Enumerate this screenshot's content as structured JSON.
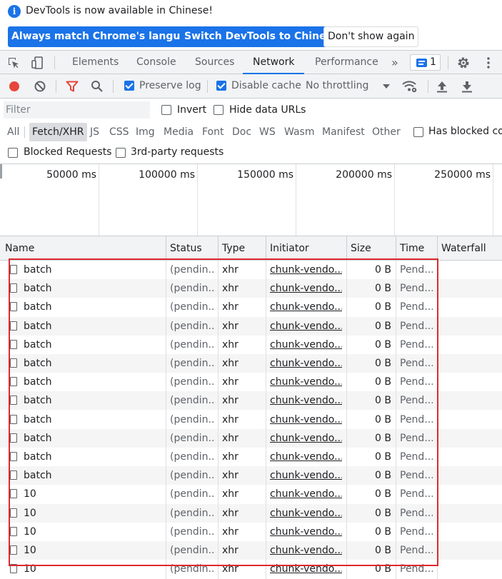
{
  "infobar": {
    "message": "DevTools is now available in Chinese!",
    "button_match": "Always match Chrome's language",
    "button_switch": "Switch DevTools to Chinese",
    "button_dismiss": "Don't show again"
  },
  "tabs": {
    "elements": "Elements",
    "console": "Console",
    "sources": "Sources",
    "network": "Network",
    "performance": "Performance",
    "more": "»",
    "issues_count": "1",
    "active": "Network"
  },
  "toolbar": {
    "preserve_log": "Preserve log",
    "preserve_log_checked": true,
    "disable_cache": "Disable cache",
    "disable_cache_checked": true,
    "throttling": "No throttling"
  },
  "filter": {
    "placeholder": "Filter",
    "invert": "Invert",
    "hide_data_urls": "Hide data URLs",
    "types": [
      "All",
      "Fetch/XHR",
      "JS",
      "CSS",
      "Img",
      "Media",
      "Font",
      "Doc",
      "WS",
      "Wasm",
      "Manifest",
      "Other"
    ],
    "active_type": "Fetch/XHR",
    "has_blocked_cookies": "Has blocked coo",
    "blocked_requests": "Blocked Requests",
    "third_party": "3rd-party requests"
  },
  "overview": {
    "ticks": [
      "50000 ms",
      "100000 ms",
      "150000 ms",
      "200000 ms",
      "250000 ms"
    ]
  },
  "table": {
    "headers": [
      "Name",
      "Status",
      "Type",
      "Initiator",
      "Size",
      "Time",
      "Waterfall"
    ],
    "rows": [
      {
        "name": "batch",
        "status": "(pendin...",
        "type": "xhr",
        "initiator": "chunk-vendo...",
        "size": "0 B",
        "time": "Pend..."
      },
      {
        "name": "batch",
        "status": "(pendin...",
        "type": "xhr",
        "initiator": "chunk-vendo...",
        "size": "0 B",
        "time": "Pend..."
      },
      {
        "name": "batch",
        "status": "(pendin...",
        "type": "xhr",
        "initiator": "chunk-vendo...",
        "size": "0 B",
        "time": "Pend..."
      },
      {
        "name": "batch",
        "status": "(pendin...",
        "type": "xhr",
        "initiator": "chunk-vendo...",
        "size": "0 B",
        "time": "Pend..."
      },
      {
        "name": "batch",
        "status": "(pendin...",
        "type": "xhr",
        "initiator": "chunk-vendo...",
        "size": "0 B",
        "time": "Pend..."
      },
      {
        "name": "batch",
        "status": "(pendin...",
        "type": "xhr",
        "initiator": "chunk-vendo...",
        "size": "0 B",
        "time": "Pend..."
      },
      {
        "name": "batch",
        "status": "(pendin...",
        "type": "xhr",
        "initiator": "chunk-vendo...",
        "size": "0 B",
        "time": "Pend..."
      },
      {
        "name": "batch",
        "status": "(pendin...",
        "type": "xhr",
        "initiator": "chunk-vendo...",
        "size": "0 B",
        "time": "Pend..."
      },
      {
        "name": "batch",
        "status": "(pendin...",
        "type": "xhr",
        "initiator": "chunk-vendo...",
        "size": "0 B",
        "time": "Pend..."
      },
      {
        "name": "batch",
        "status": "(pendin...",
        "type": "xhr",
        "initiator": "chunk-vendo...",
        "size": "0 B",
        "time": "Pend..."
      },
      {
        "name": "batch",
        "status": "(pendin...",
        "type": "xhr",
        "initiator": "chunk-vendo...",
        "size": "0 B",
        "time": "Pend..."
      },
      {
        "name": "batch",
        "status": "(pendin...",
        "type": "xhr",
        "initiator": "chunk-vendo...",
        "size": "0 B",
        "time": "Pend..."
      },
      {
        "name": "10",
        "status": "(pendin...",
        "type": "xhr",
        "initiator": "chunk-vendo...",
        "size": "0 B",
        "time": "Pend..."
      },
      {
        "name": "10",
        "status": "(pendin...",
        "type": "xhr",
        "initiator": "chunk-vendo...",
        "size": "0 B",
        "time": "Pend..."
      },
      {
        "name": "10",
        "status": "(pendin...",
        "type": "xhr",
        "initiator": "chunk-vendo...",
        "size": "0 B",
        "time": "Pend..."
      },
      {
        "name": "10",
        "status": "(pendin...",
        "type": "xhr",
        "initiator": "chunk-vendo...",
        "size": "0 B",
        "time": "Pend..."
      },
      {
        "name": "10",
        "status": "(pendin...",
        "type": "xhr",
        "initiator": "chunk-vendo...",
        "size": "0 B",
        "time": "Pend..."
      }
    ]
  },
  "colors": {
    "accent": "#1a73e8",
    "record": "#e8453c",
    "filter_icon": "#e8453c",
    "highlight": "#e0282f"
  },
  "icons": [
    "info-icon",
    "inspect-icon",
    "device-toolbar-icon",
    "issues-icon",
    "gear-icon",
    "kebab-menu-icon",
    "record-icon",
    "clear-icon",
    "filter-icon",
    "search-icon",
    "dropdown-arrow-icon",
    "network-conditions-icon",
    "import-har-icon",
    "export-har-icon",
    "document-icon"
  ]
}
